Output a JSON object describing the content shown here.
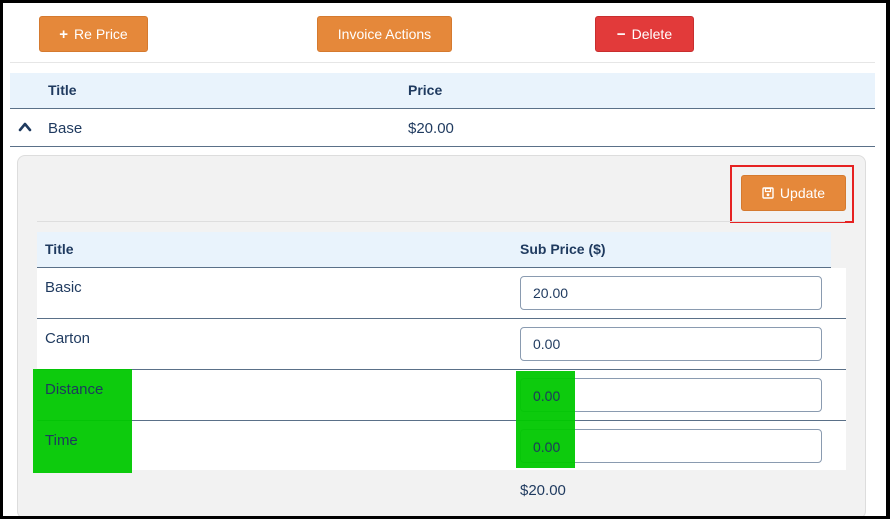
{
  "toolbar": {
    "reprice_label": "Re Price",
    "invoice_actions_label": "Invoice Actions",
    "delete_label": "Delete"
  },
  "outer_table": {
    "col_title": "Title",
    "col_price": "Price",
    "row": {
      "title": "Base",
      "price": "$20.00"
    }
  },
  "panel": {
    "update_label": "Update",
    "col_title": "Title",
    "col_subprice": "Sub Price ($)",
    "rows": [
      {
        "title": "Basic",
        "value": "20.00"
      },
      {
        "title": "Carton",
        "value": "0.00"
      },
      {
        "title": "Distance",
        "value": "0.00"
      },
      {
        "title": "Time",
        "value": "0.00"
      }
    ],
    "total": "$20.00"
  },
  "colors": {
    "accent_orange": "#e5883a",
    "danger_red": "#e23a3a",
    "highlight_green": "#00c800",
    "highlight_red_box": "#e62222"
  }
}
